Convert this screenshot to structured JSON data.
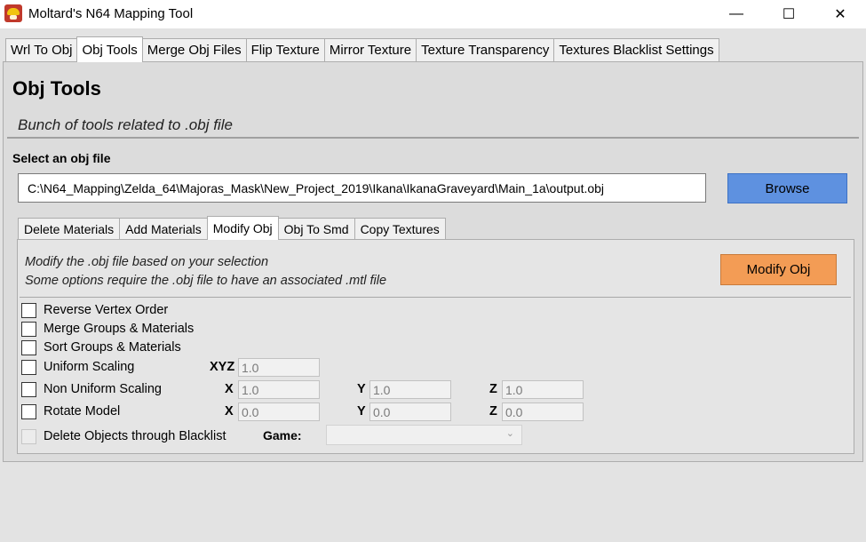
{
  "window": {
    "title": "Moltard's N64 Mapping Tool",
    "minimize_glyph": "—",
    "maximize_glyph": "☐",
    "close_glyph": "✕"
  },
  "main_tabs": [
    {
      "label": "Wrl To Obj",
      "active": false
    },
    {
      "label": "Obj Tools",
      "active": true
    },
    {
      "label": "Merge Obj Files",
      "active": false
    },
    {
      "label": "Flip Texture",
      "active": false
    },
    {
      "label": "Mirror Texture",
      "active": false
    },
    {
      "label": "Texture Transparency",
      "active": false
    },
    {
      "label": "Textures Blacklist Settings",
      "active": false
    }
  ],
  "panel": {
    "heading": "Obj Tools",
    "subtitle": "Bunch of tools related to .obj file",
    "select_label": "Select an obj file",
    "file_path": "C:\\N64_Mapping\\Zelda_64\\Majoras_Mask\\New_Project_2019\\Ikana\\IkanaGraveyard\\Main_1a\\output.obj",
    "browse_label": "Browse"
  },
  "sub_tabs": [
    {
      "label": "Delete Materials",
      "active": false
    },
    {
      "label": "Add Materials",
      "active": false
    },
    {
      "label": "Modify Obj",
      "active": true
    },
    {
      "label": "Obj To Smd",
      "active": false
    },
    {
      "label": "Copy Textures",
      "active": false
    }
  ],
  "modify_obj": {
    "description_line1": "Modify the .obj file based on your selection",
    "description_line2": "Some options require the .obj file to have an associated .mtl file",
    "button_label": "Modify Obj",
    "options": {
      "reverse_vertex": {
        "label": "Reverse Vertex Order",
        "checked": false
      },
      "merge_groups": {
        "label": "Merge Groups & Materials",
        "checked": false
      },
      "sort_groups": {
        "label": "Sort Groups & Materials",
        "checked": false
      },
      "uniform_scaling": {
        "label": "Uniform Scaling",
        "checked": false,
        "axis_label": "XYZ",
        "value": "1.0"
      },
      "non_uniform_scaling": {
        "label": "Non Uniform Scaling",
        "checked": false,
        "x_label": "X",
        "x": "1.0",
        "y_label": "Y",
        "y": "1.0",
        "z_label": "Z",
        "z": "1.0"
      },
      "rotate_model": {
        "label": "Rotate Model",
        "checked": false,
        "x_label": "X",
        "x": "0.0",
        "y_label": "Y",
        "y": "0.0",
        "z_label": "Z",
        "z": "0.0"
      },
      "delete_blacklist": {
        "label": "Delete Objects through Blacklist",
        "checked": false,
        "enabled": false,
        "game_label": "Game:",
        "game_value": ""
      }
    }
  },
  "colors": {
    "browse_button": "#5e91e0",
    "modify_button": "#f39c55"
  }
}
